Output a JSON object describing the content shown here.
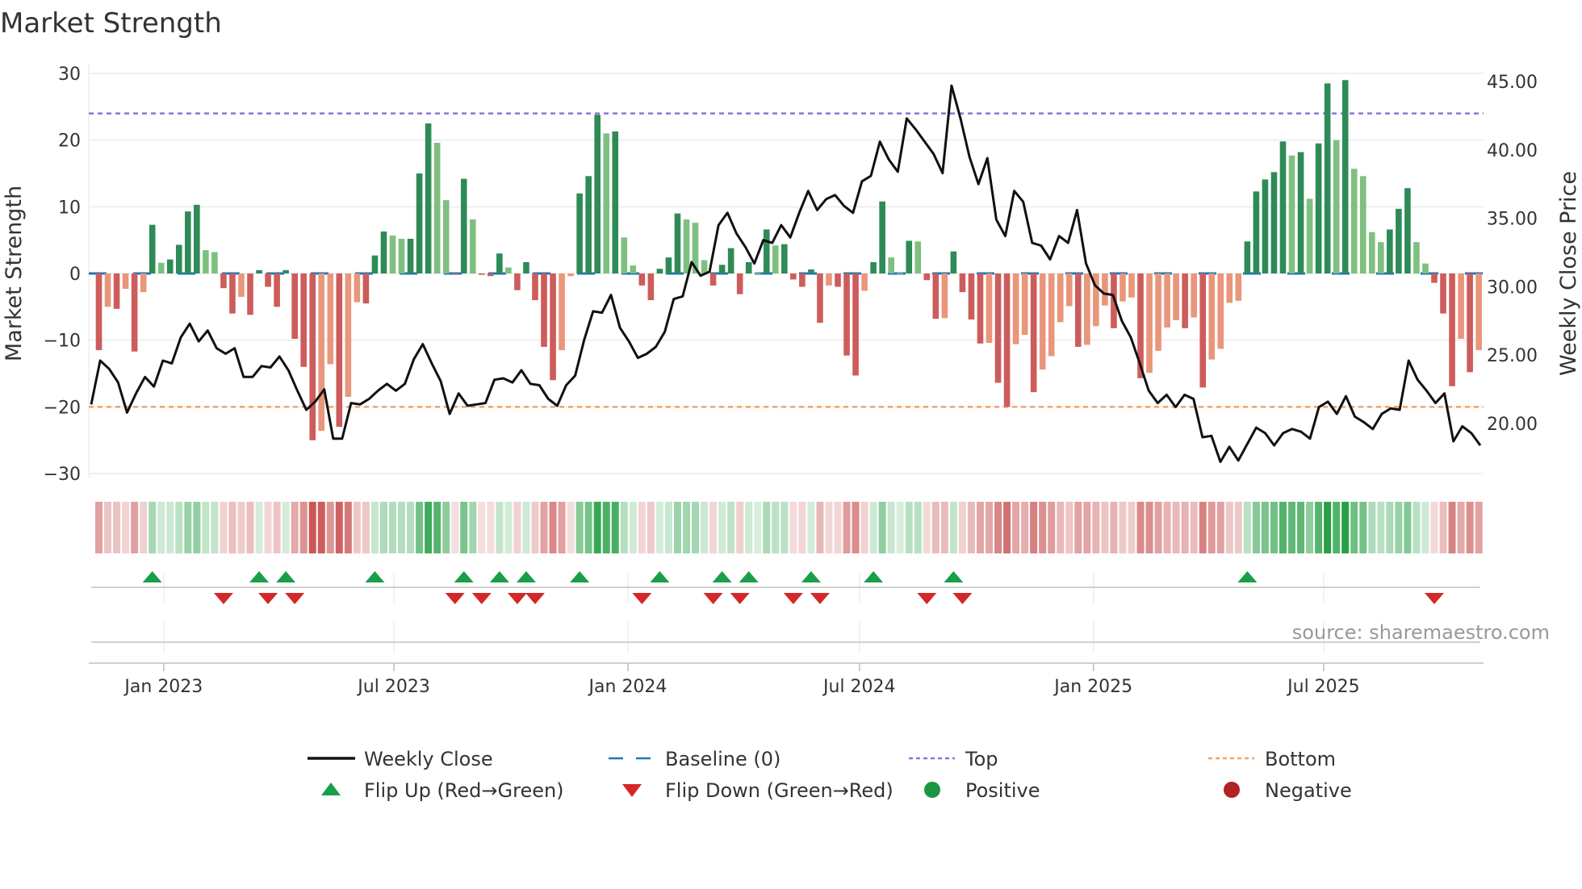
{
  "chart_data": {
    "type": "bar",
    "title": "Market Strength",
    "ylabel": "Market Strength",
    "y2label": "Weekly Close Price",
    "ylim": [
      -30,
      30
    ],
    "y2lim": [
      15.9,
      45.7
    ],
    "yticks": [
      30,
      20,
      10,
      0,
      -10,
      -20,
      -30
    ],
    "yticklabels": [
      "30",
      "20",
      "10",
      "0",
      "−10",
      "−20",
      "−30"
    ],
    "y2ticks": [
      45,
      40,
      35,
      30,
      25,
      20
    ],
    "y2ticklabels": [
      "45.00",
      "40.00",
      "35.00",
      "30.00",
      "25.00",
      "20.00"
    ],
    "x_start_date": "2022-11-11",
    "x_interval": "weekly",
    "xticks": [
      {
        "date": "2023-01-01",
        "label": "Jan 2023"
      },
      {
        "date": "2023-07-01",
        "label": "Jul 2023"
      },
      {
        "date": "2024-01-01",
        "label": "Jan 2024"
      },
      {
        "date": "2024-07-01",
        "label": "Jul 2024"
      },
      {
        "date": "2025-01-01",
        "label": "Jan 2025"
      },
      {
        "date": "2025-07-01",
        "label": "Jul 2025"
      }
    ],
    "top_level": 24,
    "bottom_level": -20,
    "baseline": 0,
    "strength": [
      -11.5,
      -5,
      -5.3,
      -2.3,
      -11.7,
      -2.8,
      7.3,
      1.6,
      2.1,
      4.3,
      9.3,
      10.3,
      3.5,
      3.2,
      -2.2,
      -6,
      -3.5,
      -6.2,
      0.5,
      -2,
      -5,
      0.5,
      -9.8,
      -14,
      -25,
      -23.6,
      -13.6,
      -23,
      -18.5,
      -4.3,
      -4.5,
      2.7,
      6.3,
      5.7,
      5.2,
      5.2,
      15,
      22.5,
      19.6,
      11,
      -0.2,
      14.2,
      8.1,
      -0.2,
      -0.4,
      3,
      0.9,
      -2.5,
      1.7,
      -4,
      -11,
      -16,
      -11.5,
      -0.4,
      12,
      14.6,
      23.8,
      21,
      21.3,
      5.4,
      1.2,
      -1.8,
      -4,
      0.7,
      2.4,
      9,
      8.1,
      7.6,
      2,
      -1.8,
      1.3,
      3.8,
      -3.1,
      1.7,
      0.1,
      6.6,
      4.2,
      4.4,
      -0.9,
      -2,
      0.6,
      -7.4,
      -1.8,
      -2,
      -12.3,
      -15.3,
      -2.6,
      1.7,
      10.8,
      2.4,
      0.1,
      4.9,
      4.8,
      -1,
      -6.8,
      -6.7,
      3.3,
      -2.8,
      -6.9,
      -10.5,
      -10.4,
      -16.4,
      -20,
      -10.6,
      -9.2,
      -17.8,
      -14.4,
      -12.4,
      -7.3,
      -4.9,
      -11,
      -10.7,
      -7.9,
      -4.8,
      -8.2,
      -4.2,
      -3.6,
      -15.7,
      -14.9,
      -11.6,
      -8.1,
      -7,
      -8.2,
      -6.6,
      -17.1,
      -12.9,
      -11.3,
      -4.4,
      -4.1,
      4.8,
      12.3,
      14.1,
      15.2,
      19.8,
      17.7,
      18.2,
      11.2,
      19.5,
      28.5,
      20,
      29,
      15.7,
      14.6,
      6.2,
      4.7,
      6.6,
      9.7,
      12.8,
      4.7,
      1.5,
      -1.4,
      -6,
      -16.9,
      -9.8,
      -14.8,
      -11.5
    ],
    "weekly_close": [
      21.4,
      24.6,
      24.0,
      23.0,
      20.8,
      22.2,
      23.4,
      22.7,
      24.6,
      24.4,
      26.3,
      27.3,
      26.0,
      26.8,
      25.5,
      25.1,
      25.5,
      23.4,
      23.4,
      24.2,
      24.1,
      24.9,
      23.9,
      22.4,
      21.0,
      21.6,
      22.5,
      18.9,
      18.9,
      21.5,
      21.4,
      21.8,
      22.4,
      22.9,
      22.4,
      22.9,
      24.7,
      25.8,
      24.4,
      23.1,
      20.7,
      22.2,
      21.3,
      21.4,
      21.5,
      23.2,
      23.3,
      23.0,
      23.9,
      22.9,
      22.8,
      21.8,
      21.3,
      22.8,
      23.5,
      26.1,
      28.2,
      28.1,
      29.4,
      27.0,
      26.0,
      24.8,
      25.1,
      25.6,
      26.7,
      29.1,
      29.3,
      31.8,
      30.8,
      31.1,
      34.5,
      35.4,
      33.9,
      32.9,
      31.7,
      33.4,
      33.2,
      34.5,
      33.6,
      35.4,
      37.0,
      35.6,
      36.4,
      36.7,
      35.9,
      35.4,
      37.7,
      38.1,
      40.6,
      39.3,
      38.4,
      42.3,
      41.5,
      40.6,
      39.7,
      38.3,
      44.7,
      42.3,
      39.5,
      37.5,
      39.4,
      34.9,
      33.7,
      37.0,
      36.2,
      33.2,
      33.0,
      32.0,
      33.7,
      33.2,
      35.6,
      31.7,
      30.1,
      29.5,
      29.4,
      27.5,
      26.3,
      24.4,
      22.4,
      21.5,
      22.1,
      21.2,
      22.1,
      21.8,
      19.0,
      19.1,
      17.2,
      18.3,
      17.3,
      18.5,
      19.7,
      19.3,
      18.4,
      19.3,
      19.6,
      19.4,
      18.9,
      21.2,
      21.6,
      20.7,
      22.0,
      20.5,
      20.1,
      19.6,
      20.7,
      21.1,
      21.0,
      24.6,
      23.2,
      22.4,
      21.5,
      22.2,
      18.7,
      19.8,
      19.3,
      18.4
    ],
    "flip_up_weeks": [
      6,
      18,
      21,
      31,
      41,
      45,
      48,
      54,
      63,
      70,
      73,
      80,
      87,
      96,
      129
    ],
    "flip_down_weeks": [
      14,
      19,
      22,
      40,
      43,
      47,
      49,
      61,
      69,
      72,
      78,
      81,
      93,
      97,
      150
    ],
    "legend": [
      {
        "label": "Weekly Close",
        "kind": "line",
        "color": "#111111"
      },
      {
        "label": "Baseline (0)",
        "kind": "dash",
        "color": "#1f77b4"
      },
      {
        "label": "Top",
        "kind": "dot",
        "color": "#9370db"
      },
      {
        "label": "Bottom",
        "kind": "dot",
        "color": "#f4a460"
      },
      {
        "label": "Flip Up (Red→Green)",
        "kind": "tri-up",
        "color": "#1a9e4a"
      },
      {
        "label": "Flip Down (Green→Red)",
        "kind": "tri-down",
        "color": "#d62728"
      },
      {
        "label": "Positive",
        "kind": "circle",
        "color": "#1a9641"
      },
      {
        "label": "Negative",
        "kind": "circle",
        "color": "#b22222"
      }
    ],
    "legend_placement": "bottom-center",
    "colors": {
      "pos_strong": "#2e8b57",
      "pos_weak": "#7fbf7f",
      "neg_strong": "#cd5c5c",
      "neg_weak": "#e9967a",
      "grid": "#ececec"
    },
    "source": "source: sharemaestro.com"
  }
}
